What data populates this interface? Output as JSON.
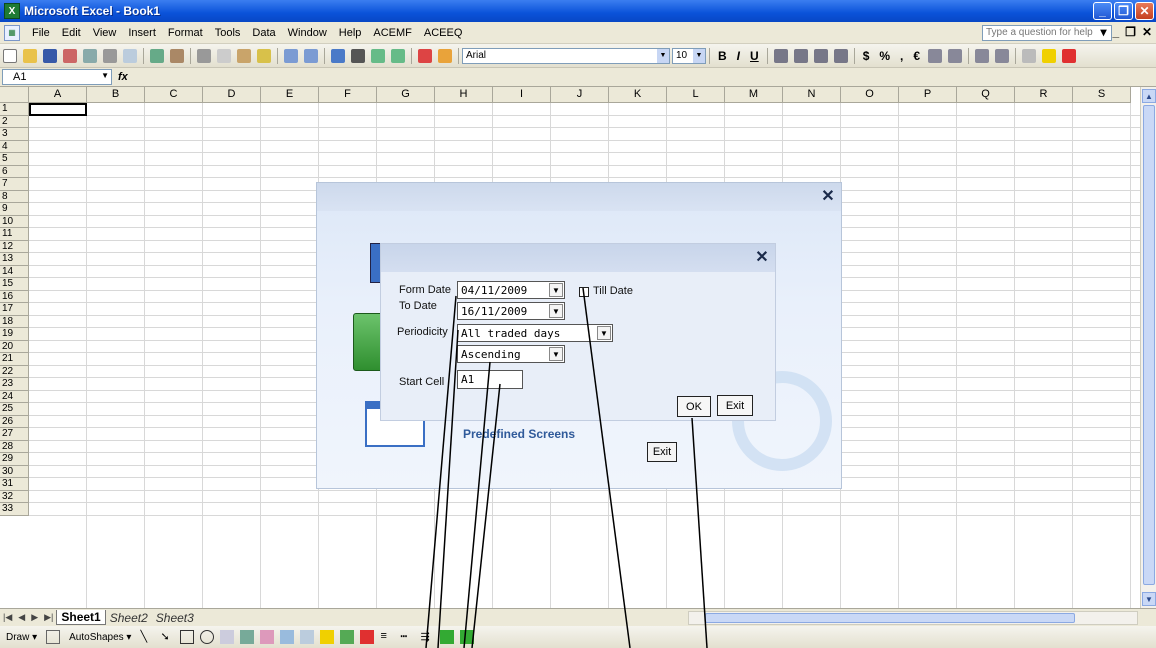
{
  "window": {
    "title": "Microsoft Excel - Book1",
    "app_icon": "X",
    "help_placeholder": "Type a question for help"
  },
  "menu": [
    "File",
    "Edit",
    "View",
    "Insert",
    "Format",
    "Tools",
    "Data",
    "Window",
    "Help",
    "ACEMF",
    "ACEEQ"
  ],
  "toolbar": {
    "font": "Arial",
    "size": "10",
    "bold": "B",
    "italic": "I",
    "underline": "U",
    "currency": "$",
    "percent": "%",
    "comma": ",",
    "euro": "€"
  },
  "formula_bar": {
    "name_box": "A1",
    "fx": "fx"
  },
  "columns": [
    "A",
    "B",
    "C",
    "D",
    "E",
    "F",
    "G",
    "H",
    "I",
    "J",
    "K",
    "L",
    "M",
    "N",
    "O",
    "P",
    "Q",
    "R",
    "S"
  ],
  "rows": [
    "1",
    "2",
    "3",
    "4",
    "5",
    "6",
    "7",
    "8",
    "9",
    "10",
    "11",
    "12",
    "13",
    "14",
    "15",
    "16",
    "17",
    "18",
    "19",
    "20",
    "21",
    "22",
    "23",
    "24",
    "25",
    "26",
    "27",
    "28",
    "29",
    "30",
    "31",
    "32",
    "33"
  ],
  "sheets": {
    "tabs": [
      "Sheet1",
      "Sheet2",
      "Sheet3"
    ],
    "active": "Sheet1"
  },
  "drawbar": {
    "draw": "Draw ▾",
    "autoshapes": "AutoShapes ▾"
  },
  "outer_dialog": {
    "predefined": "Predefined Screens",
    "exit": "Exit",
    "close": "✕"
  },
  "inner_dialog": {
    "close": "✕",
    "from_date_label": "Form Date",
    "from_date": "04/11/2009",
    "to_date_label": "To Date",
    "to_date": "16/11/2009",
    "till_date_label": "Till Date",
    "periodicity_label": "Periodicity",
    "periodicity": "All traded days",
    "order": "Ascending",
    "start_cell_label": "Start Cell",
    "start_cell": "A1",
    "ok": "OK",
    "exit": "Exit"
  },
  "colors": {
    "title_blue": "#0a52d9",
    "chrome": "#ece9d8",
    "dialog_bg": "#e9f0fb"
  }
}
